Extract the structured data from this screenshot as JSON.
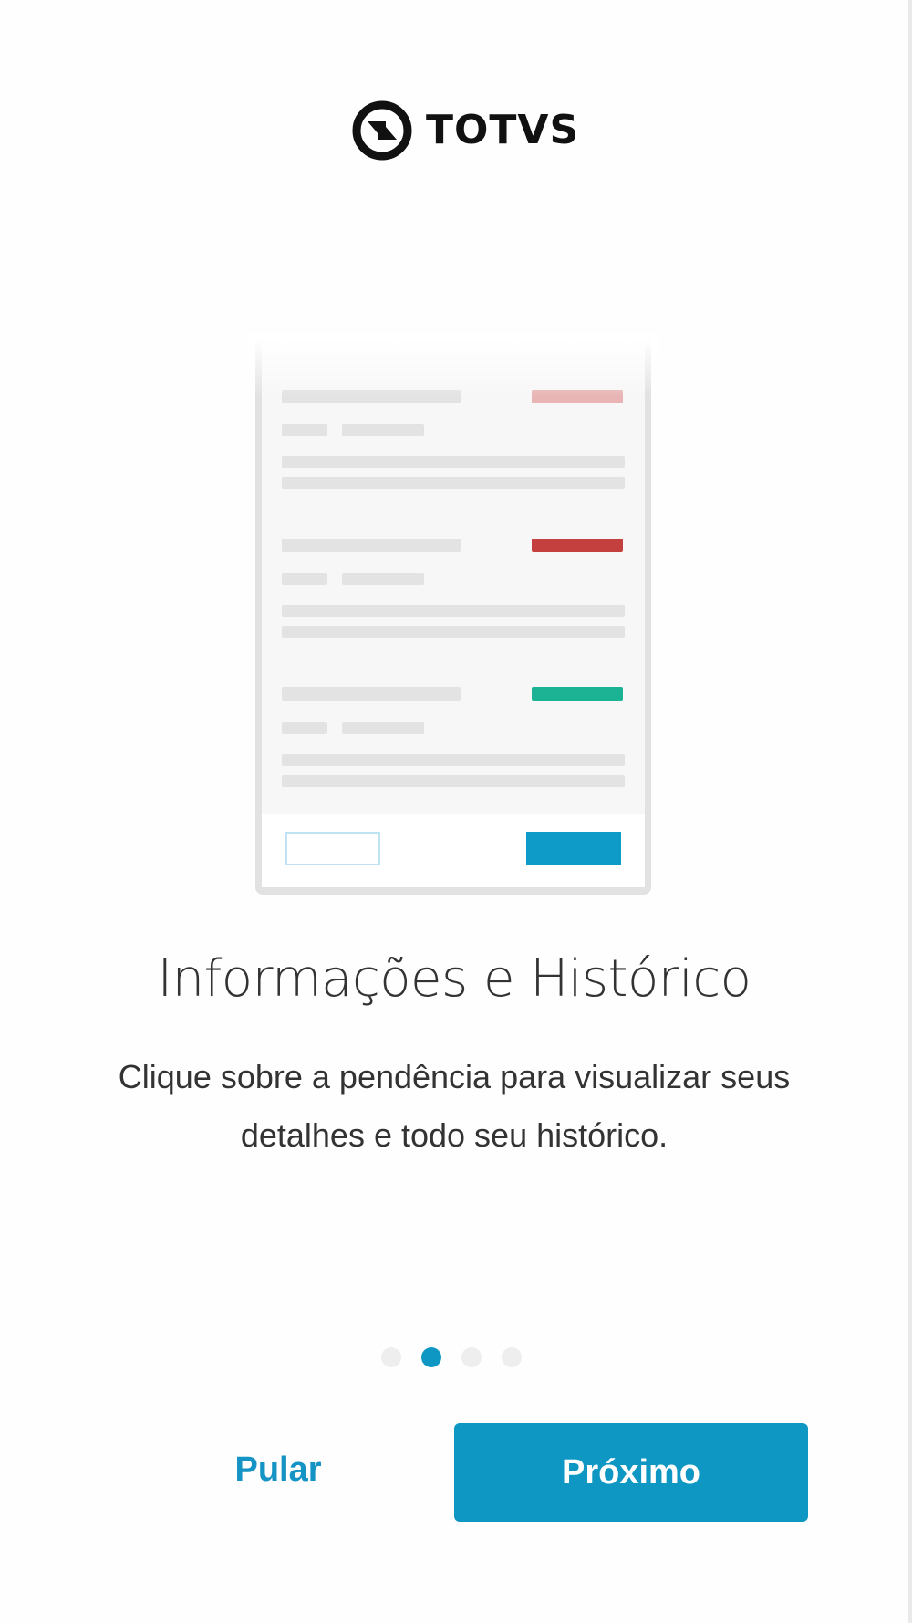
{
  "brand": {
    "name": "TOTVS",
    "logo_icon": "totvs-logo-icon"
  },
  "illustration": {
    "status_colors": [
      "#e8b4b4",
      "#c4403e",
      "#1bb394"
    ],
    "accent": "#0f9bc7"
  },
  "slide": {
    "title": "Informações e Histórico",
    "description": "Clique sobre a pendência para visualizar seus detalhes e todo seu histórico."
  },
  "pagination": {
    "total": 4,
    "current": 2
  },
  "actions": {
    "skip_label": "Pular",
    "next_label": "Próximo"
  },
  "colors": {
    "primary": "#0f97c3",
    "text": "#333333",
    "dot_inactive": "#eeeeee"
  }
}
